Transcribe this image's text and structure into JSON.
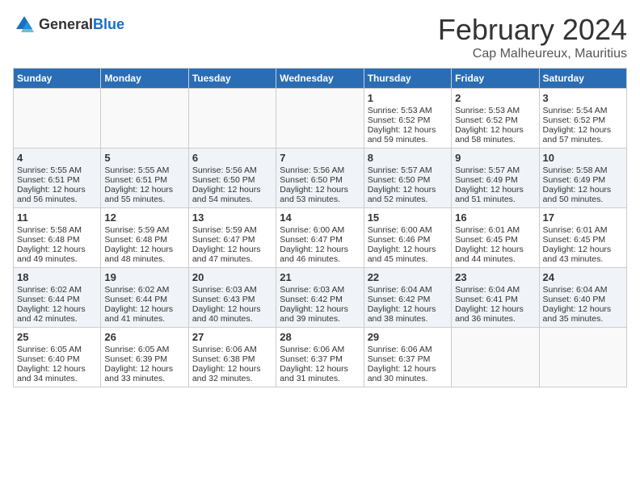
{
  "logo": {
    "text_general": "General",
    "text_blue": "Blue"
  },
  "title": "February 2024",
  "subtitle": "Cap Malheureux, Mauritius",
  "days_header": [
    "Sunday",
    "Monday",
    "Tuesday",
    "Wednesday",
    "Thursday",
    "Friday",
    "Saturday"
  ],
  "weeks": [
    [
      {
        "day": "",
        "info": ""
      },
      {
        "day": "",
        "info": ""
      },
      {
        "day": "",
        "info": ""
      },
      {
        "day": "",
        "info": ""
      },
      {
        "day": "1",
        "info": "Sunrise: 5:53 AM\nSunset: 6:52 PM\nDaylight: 12 hours and 59 minutes."
      },
      {
        "day": "2",
        "info": "Sunrise: 5:53 AM\nSunset: 6:52 PM\nDaylight: 12 hours and 58 minutes."
      },
      {
        "day": "3",
        "info": "Sunrise: 5:54 AM\nSunset: 6:52 PM\nDaylight: 12 hours and 57 minutes."
      }
    ],
    [
      {
        "day": "4",
        "info": "Sunrise: 5:55 AM\nSunset: 6:51 PM\nDaylight: 12 hours and 56 minutes."
      },
      {
        "day": "5",
        "info": "Sunrise: 5:55 AM\nSunset: 6:51 PM\nDaylight: 12 hours and 55 minutes."
      },
      {
        "day": "6",
        "info": "Sunrise: 5:56 AM\nSunset: 6:50 PM\nDaylight: 12 hours and 54 minutes."
      },
      {
        "day": "7",
        "info": "Sunrise: 5:56 AM\nSunset: 6:50 PM\nDaylight: 12 hours and 53 minutes."
      },
      {
        "day": "8",
        "info": "Sunrise: 5:57 AM\nSunset: 6:50 PM\nDaylight: 12 hours and 52 minutes."
      },
      {
        "day": "9",
        "info": "Sunrise: 5:57 AM\nSunset: 6:49 PM\nDaylight: 12 hours and 51 minutes."
      },
      {
        "day": "10",
        "info": "Sunrise: 5:58 AM\nSunset: 6:49 PM\nDaylight: 12 hours and 50 minutes."
      }
    ],
    [
      {
        "day": "11",
        "info": "Sunrise: 5:58 AM\nSunset: 6:48 PM\nDaylight: 12 hours and 49 minutes."
      },
      {
        "day": "12",
        "info": "Sunrise: 5:59 AM\nSunset: 6:48 PM\nDaylight: 12 hours and 48 minutes."
      },
      {
        "day": "13",
        "info": "Sunrise: 5:59 AM\nSunset: 6:47 PM\nDaylight: 12 hours and 47 minutes."
      },
      {
        "day": "14",
        "info": "Sunrise: 6:00 AM\nSunset: 6:47 PM\nDaylight: 12 hours and 46 minutes."
      },
      {
        "day": "15",
        "info": "Sunrise: 6:00 AM\nSunset: 6:46 PM\nDaylight: 12 hours and 45 minutes."
      },
      {
        "day": "16",
        "info": "Sunrise: 6:01 AM\nSunset: 6:45 PM\nDaylight: 12 hours and 44 minutes."
      },
      {
        "day": "17",
        "info": "Sunrise: 6:01 AM\nSunset: 6:45 PM\nDaylight: 12 hours and 43 minutes."
      }
    ],
    [
      {
        "day": "18",
        "info": "Sunrise: 6:02 AM\nSunset: 6:44 PM\nDaylight: 12 hours and 42 minutes."
      },
      {
        "day": "19",
        "info": "Sunrise: 6:02 AM\nSunset: 6:44 PM\nDaylight: 12 hours and 41 minutes."
      },
      {
        "day": "20",
        "info": "Sunrise: 6:03 AM\nSunset: 6:43 PM\nDaylight: 12 hours and 40 minutes."
      },
      {
        "day": "21",
        "info": "Sunrise: 6:03 AM\nSunset: 6:42 PM\nDaylight: 12 hours and 39 minutes."
      },
      {
        "day": "22",
        "info": "Sunrise: 6:04 AM\nSunset: 6:42 PM\nDaylight: 12 hours and 38 minutes."
      },
      {
        "day": "23",
        "info": "Sunrise: 6:04 AM\nSunset: 6:41 PM\nDaylight: 12 hours and 36 minutes."
      },
      {
        "day": "24",
        "info": "Sunrise: 6:04 AM\nSunset: 6:40 PM\nDaylight: 12 hours and 35 minutes."
      }
    ],
    [
      {
        "day": "25",
        "info": "Sunrise: 6:05 AM\nSunset: 6:40 PM\nDaylight: 12 hours and 34 minutes."
      },
      {
        "day": "26",
        "info": "Sunrise: 6:05 AM\nSunset: 6:39 PM\nDaylight: 12 hours and 33 minutes."
      },
      {
        "day": "27",
        "info": "Sunrise: 6:06 AM\nSunset: 6:38 PM\nDaylight: 12 hours and 32 minutes."
      },
      {
        "day": "28",
        "info": "Sunrise: 6:06 AM\nSunset: 6:37 PM\nDaylight: 12 hours and 31 minutes."
      },
      {
        "day": "29",
        "info": "Sunrise: 6:06 AM\nSunset: 6:37 PM\nDaylight: 12 hours and 30 minutes."
      },
      {
        "day": "",
        "info": ""
      },
      {
        "day": "",
        "info": ""
      }
    ]
  ]
}
